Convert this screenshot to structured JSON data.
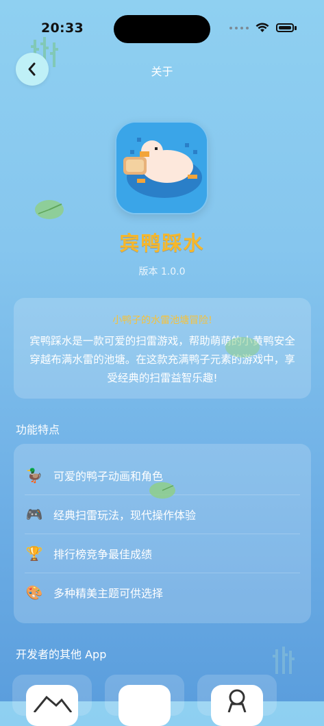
{
  "status": {
    "time": "20:33"
  },
  "nav": {
    "title": "关于",
    "back_icon": "chevron-left-icon"
  },
  "app": {
    "name": "宾鸭踩水",
    "version": "版本 1.0.0",
    "tagline": "小鸭子的水雷池塘冒险!",
    "description": "宾鸭踩水是一款可爱的扫雷游戏，帮助萌萌的小黄鸭安全穿越布满水雷的池塘。在这款充满鸭子元素的游戏中，享受经典的扫雷益智乐趣!"
  },
  "features": {
    "title": "功能特点",
    "items": [
      {
        "emoji": "🦆",
        "label": "可爱的鸭子动画和角色"
      },
      {
        "emoji": "🎮",
        "label": "经典扫雷玩法，现代操作体验"
      },
      {
        "emoji": "🏆",
        "label": "排行榜竞争最佳成绩"
      },
      {
        "emoji": "🎨",
        "label": "多种精美主题可供选择"
      }
    ]
  },
  "other_apps": {
    "title": "开发者的其他 App"
  },
  "colors": {
    "accent": "#f6b72b",
    "back_button": "#bff0f7"
  }
}
